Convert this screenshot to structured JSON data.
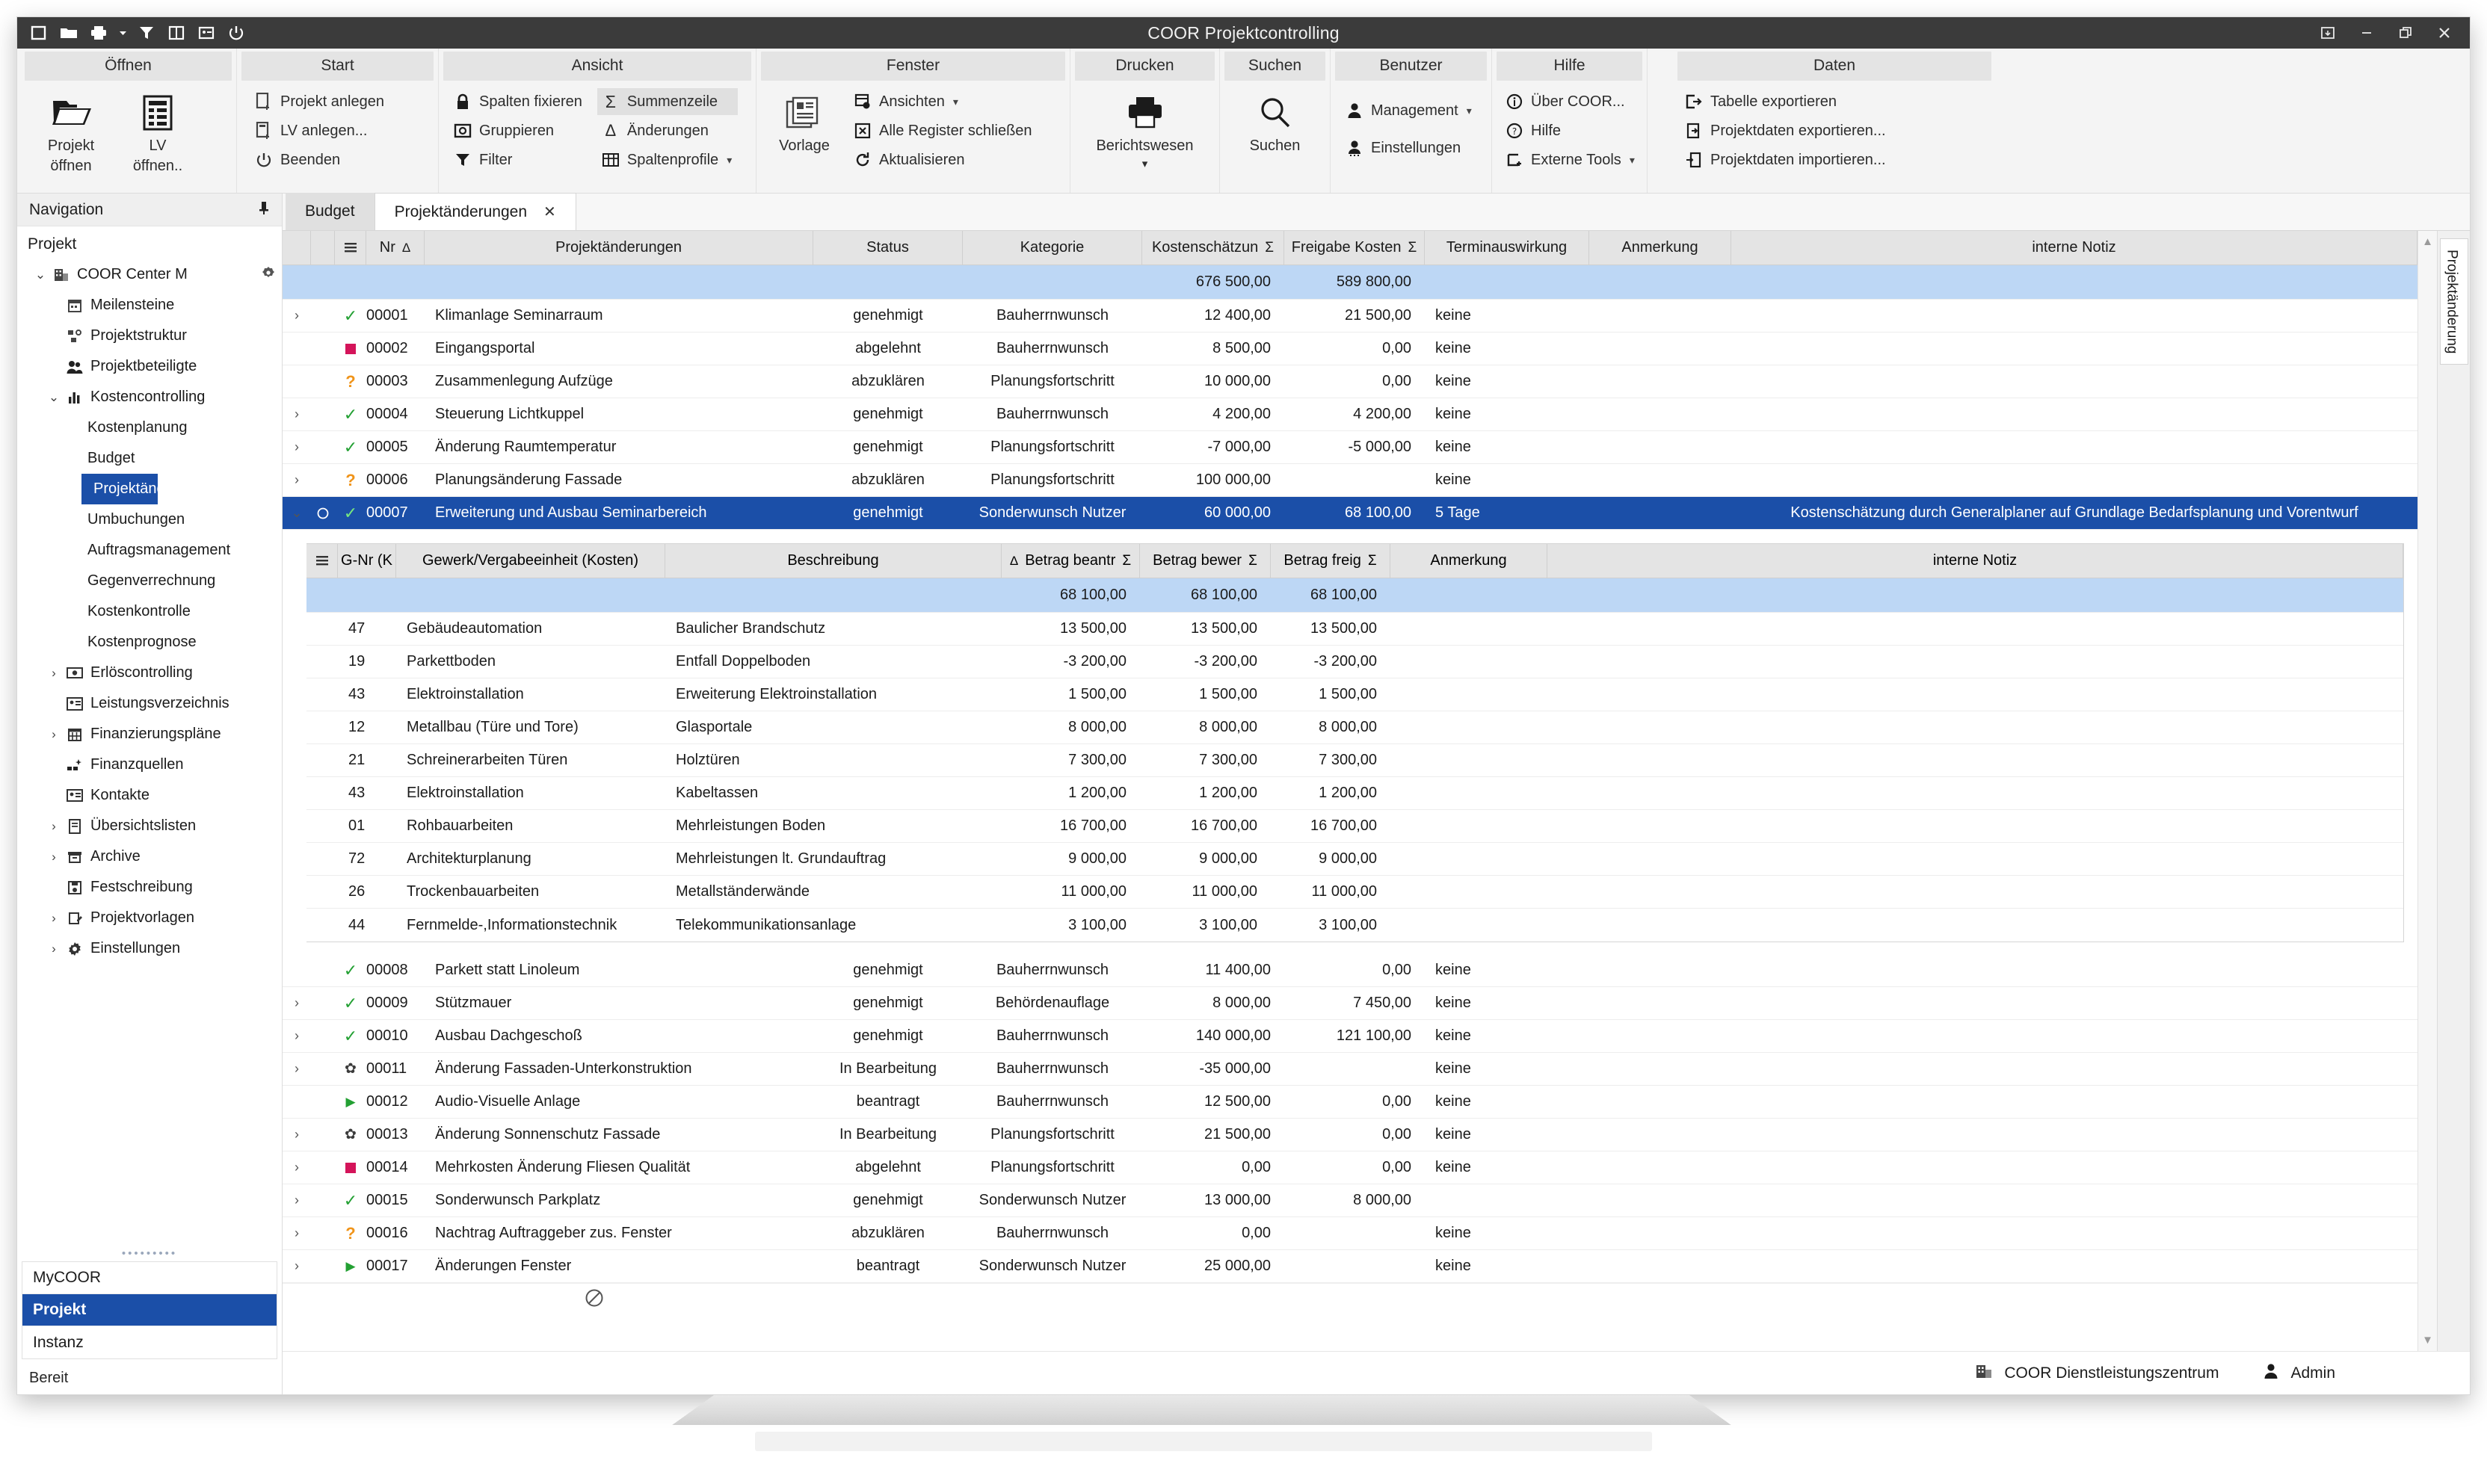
{
  "window": {
    "title": "COOR Projektcontrolling",
    "quick_access": [
      "window-icon",
      "open-folder-icon",
      "print-icon",
      "filter-icon",
      "report-icon",
      "card-icon",
      "power-icon"
    ],
    "controls": [
      "restore-down-icon",
      "minimize-icon",
      "maximize-icon",
      "close-icon"
    ]
  },
  "ribbon": {
    "groups": [
      {
        "title": "Öffnen",
        "big_buttons": [
          {
            "label_1": "Projekt",
            "label_2": "öffnen",
            "icon": "folder-open-icon"
          },
          {
            "label_1": "LV",
            "label_2": "öffnen..",
            "icon": "lv-open-icon"
          }
        ],
        "small_buttons": []
      },
      {
        "title": "Start",
        "big_buttons": [],
        "small_buttons": [
          {
            "label": "Projekt anlegen",
            "icon": "project-new-icon"
          },
          {
            "label": "LV anlegen...",
            "icon": "lv-new-icon"
          },
          {
            "label": "Beenden",
            "icon": "power-icon"
          }
        ]
      },
      {
        "title": "Ansicht",
        "big_buttons": [],
        "small_buttons": [
          {
            "label": "Spalten fixieren",
            "icon": "lock-icon"
          },
          {
            "label": "Gruppieren",
            "icon": "group-icon"
          },
          {
            "label": "Filter",
            "icon": "filter-icon"
          }
        ],
        "small_buttons_2": [
          {
            "label": "Summenzeile",
            "icon": "sigma-icon",
            "active": true
          },
          {
            "label": "Änderungen",
            "icon": "delta-icon"
          },
          {
            "label": "Spaltenprofile",
            "icon": "table-icon",
            "caret": true
          }
        ]
      },
      {
        "title": "Fenster",
        "big_buttons": [
          {
            "label_1": "Vorlage",
            "label_2": "",
            "icon": "template-icon"
          }
        ],
        "small_buttons": [
          {
            "label": "Ansichten",
            "icon": "views-icon",
            "caret": true
          },
          {
            "label": "Alle Register schließen",
            "icon": "close-box-icon"
          },
          {
            "label": "Aktualisieren",
            "icon": "refresh-icon"
          }
        ]
      },
      {
        "title": "Drucken",
        "big_buttons": [
          {
            "label_1": "Berichtswesen",
            "label_2": "▾",
            "icon": "printer-icon"
          }
        ],
        "small_buttons": []
      },
      {
        "title": "Suchen",
        "big_buttons": [
          {
            "label_1": "Suchen",
            "label_2": "",
            "icon": "search-icon"
          }
        ],
        "small_buttons": []
      },
      {
        "title": "Benutzer",
        "big_buttons": [],
        "small_buttons": [
          {
            "label": "Management",
            "icon": "user-icon",
            "caret": true
          },
          {
            "label": "Einstellungen",
            "icon": "user-settings-icon"
          }
        ]
      },
      {
        "title": "Hilfe",
        "big_buttons": [],
        "small_buttons": [
          {
            "label": "Über COOR...",
            "icon": "info-icon"
          },
          {
            "label": "Hilfe",
            "icon": "question-icon"
          },
          {
            "label": "Externe Tools",
            "icon": "tools-icon",
            "caret": true
          }
        ]
      },
      {
        "title": "Daten",
        "big_buttons": [],
        "small_buttons": [
          {
            "label": "Tabelle exportieren",
            "icon": "export-table-icon"
          },
          {
            "label": "Projektdaten exportieren...",
            "icon": "export-data-icon"
          },
          {
            "label": "Projektdaten importieren...",
            "icon": "import-data-icon"
          }
        ]
      }
    ]
  },
  "sidebar": {
    "header": "Navigation",
    "pin_icon": "pin-icon",
    "section_title": "Projekt",
    "tree": [
      {
        "label": "COOR Center M",
        "icon": "building-icon",
        "expander": "chevron-down",
        "indent": 0,
        "gear": true
      },
      {
        "label": "Meilensteine",
        "icon": "calendar-icon",
        "expander": "",
        "indent": 1
      },
      {
        "label": "Projektstruktur",
        "icon": "structure-icon",
        "expander": "",
        "indent": 1
      },
      {
        "label": "Projektbeteiligte",
        "icon": "people-icon",
        "expander": "",
        "indent": 1
      },
      {
        "label": "Kostencontrolling",
        "icon": "bars-icon",
        "expander": "chevron-down",
        "indent": 1
      },
      {
        "label": "Kostenplanung",
        "icon": "",
        "expander": "",
        "indent": 2
      },
      {
        "label": "Budget",
        "icon": "",
        "expander": "",
        "indent": 2
      },
      {
        "label": "Projektänderungen",
        "icon": "",
        "expander": "",
        "indent": 2,
        "selected": true
      },
      {
        "label": "Umbuchungen",
        "icon": "",
        "expander": "",
        "indent": 2
      },
      {
        "label": "Auftragsmanagement",
        "icon": "",
        "expander": "",
        "indent": 2
      },
      {
        "label": "Gegenverrechnung",
        "icon": "",
        "expander": "",
        "indent": 2
      },
      {
        "label": "Kostenkontrolle",
        "icon": "",
        "expander": "",
        "indent": 2
      },
      {
        "label": "Kostenprognose",
        "icon": "",
        "expander": "",
        "indent": 2
      },
      {
        "label": "Erlöscontrolling",
        "icon": "money-icon",
        "expander": "chevron-right",
        "indent": 1
      },
      {
        "label": "Leistungsverzeichnis",
        "icon": "lv-icon",
        "expander": "",
        "indent": 1
      },
      {
        "label": "Finanzierungspläne",
        "icon": "calendar-grid-icon",
        "expander": "chevron-right",
        "indent": 1
      },
      {
        "label": "Finanzquellen",
        "icon": "sources-icon",
        "expander": "",
        "indent": 1
      },
      {
        "label": "Kontakte",
        "icon": "contact-card-icon",
        "expander": "",
        "indent": 1
      },
      {
        "label": "Übersichtslisten",
        "icon": "document-icon",
        "expander": "chevron-right",
        "indent": 1
      },
      {
        "label": "Archive",
        "icon": "archive-icon",
        "expander": "chevron-right",
        "indent": 1
      },
      {
        "label": "Festschreibung",
        "icon": "save-icon",
        "expander": "",
        "indent": 1
      },
      {
        "label": "Projektvorlagen",
        "icon": "clipboard-edit-icon",
        "expander": "chevron-right",
        "indent": 1
      },
      {
        "label": "Einstellungen",
        "icon": "gear-icon",
        "expander": "chevron-right",
        "indent": 1
      }
    ],
    "panels": [
      {
        "label": "MyCOOR",
        "selected": false
      },
      {
        "label": "Projekt",
        "selected": true
      },
      {
        "label": "Instanz",
        "selected": false
      }
    ],
    "status": "Bereit"
  },
  "tabs": [
    {
      "label": "Budget",
      "active": false,
      "closable": false
    },
    {
      "label": "Projektänderungen",
      "active": true,
      "closable": true,
      "close_label": "✕"
    }
  ],
  "vertical_tab": "Projektänderung",
  "grid": {
    "columns": [
      {
        "key": "menu",
        "label": "",
        "icon": "grid-menu-icon"
      },
      {
        "key": "nr",
        "label": "Nr",
        "tri": "Δ"
      },
      {
        "key": "name",
        "label": "Projektänderungen"
      },
      {
        "key": "status",
        "label": "Status"
      },
      {
        "key": "kategorie",
        "label": "Kategorie"
      },
      {
        "key": "kostenschaetzung",
        "label": "Kostenschätzun",
        "sigma": "Σ"
      },
      {
        "key": "freigabe",
        "label": "Freigabe Kosten",
        "sigma": "Σ"
      },
      {
        "key": "termin",
        "label": "Terminauswirkung"
      },
      {
        "key": "anmerkung",
        "label": "Anmerkung"
      },
      {
        "key": "notiz",
        "label": "interne Notiz"
      }
    ],
    "total_row": {
      "kostenschaetzung": "676 500,00",
      "freigabe": "589 800,00"
    },
    "rows": [
      {
        "expander": true,
        "status_icon": "check",
        "nr": "00001",
        "name": "Klimanlage Seminarraum",
        "status": "genehmigt",
        "kategorie": "Bauherrnwunsch",
        "kostenschaetzung": "12 400,00",
        "freigabe": "21 500,00",
        "termin": "keine",
        "anmerkung": "",
        "notiz": ""
      },
      {
        "expander": false,
        "status_icon": "square",
        "nr": "00002",
        "name": "Eingangsportal",
        "status": "abgelehnt",
        "kategorie": "Bauherrnwunsch",
        "kostenschaetzung": "8 500,00",
        "freigabe": "0,00",
        "termin": "keine",
        "anmerkung": "",
        "notiz": ""
      },
      {
        "expander": false,
        "status_icon": "question",
        "nr": "00003",
        "name": "Zusammenlegung Aufzüge",
        "status": "abzuklären",
        "kategorie": "Planungsfortschritt",
        "kostenschaetzung": "10 000,00",
        "freigabe": "0,00",
        "termin": "keine",
        "anmerkung": "",
        "notiz": ""
      },
      {
        "expander": true,
        "status_icon": "check",
        "nr": "00004",
        "name": "Steuerung Lichtkuppel",
        "status": "genehmigt",
        "kategorie": "Bauherrnwunsch",
        "kostenschaetzung": "4 200,00",
        "freigabe": "4 200,00",
        "termin": "keine",
        "anmerkung": "",
        "notiz": ""
      },
      {
        "expander": true,
        "status_icon": "check",
        "nr": "00005",
        "name": "Änderung Raumtemperatur",
        "status": "genehmigt",
        "kategorie": "Planungsfortschritt",
        "kostenschaetzung": "-7 000,00",
        "freigabe": "-5 000,00",
        "termin": "keine",
        "anmerkung": "",
        "notiz": ""
      },
      {
        "expander": true,
        "status_icon": "question",
        "nr": "00006",
        "name": "Planungsänderung Fassade",
        "status": "abzuklären",
        "kategorie": "Planungsfortschritt",
        "kostenschaetzung": "100 000,00",
        "freigabe": "",
        "termin": "keine",
        "anmerkung": "",
        "notiz": ""
      },
      {
        "expander": true,
        "expanded": true,
        "selected": true,
        "circle": true,
        "status_icon": "check",
        "nr": "00007",
        "name": "Erweiterung und Ausbau Seminarbereich",
        "status": "genehmigt",
        "kategorie": "Sonderwunsch Nutzer",
        "kostenschaetzung": "60 000,00",
        "freigabe": "68 100,00",
        "termin": "5 Tage",
        "anmerkung": "",
        "notiz": "Kostenschätzung durch Generalplaner auf Grundlage Bedarfsplanung und Vorentwurf"
      },
      {
        "expander": false,
        "status_icon": "check",
        "nr": "00008",
        "name": "Parkett statt Linoleum",
        "status": "genehmigt",
        "kategorie": "Bauherrnwunsch",
        "kostenschaetzung": "11 400,00",
        "freigabe": "0,00",
        "termin": "keine",
        "anmerkung": "",
        "notiz": ""
      },
      {
        "expander": true,
        "status_icon": "check",
        "nr": "00009",
        "name": "Stützmauer",
        "status": "genehmigt",
        "kategorie": "Behördenauflage",
        "kostenschaetzung": "8 000,00",
        "freigabe": "7 450,00",
        "termin": "keine",
        "anmerkung": "",
        "notiz": ""
      },
      {
        "expander": true,
        "status_icon": "check",
        "nr": "00010",
        "name": "Ausbau Dachgeschoß",
        "status": "genehmigt",
        "kategorie": "Bauherrnwunsch",
        "kostenschaetzung": "140 000,00",
        "freigabe": "121 100,00",
        "termin": "keine",
        "anmerkung": "",
        "notiz": ""
      },
      {
        "expander": true,
        "status_icon": "gear",
        "nr": "00011",
        "name": "Änderung Fassaden-Unterkonstruktion",
        "status": "In Bearbeitung",
        "kategorie": "Bauherrnwunsch",
        "kostenschaetzung": "-35 000,00",
        "freigabe": "",
        "termin": "keine",
        "anmerkung": "",
        "notiz": ""
      },
      {
        "expander": false,
        "status_icon": "triangle",
        "nr": "00012",
        "name": "Audio-Visuelle Anlage",
        "status": "beantragt",
        "kategorie": "Bauherrnwunsch",
        "kostenschaetzung": "12 500,00",
        "freigabe": "0,00",
        "termin": "keine",
        "anmerkung": "",
        "notiz": ""
      },
      {
        "expander": true,
        "status_icon": "gear",
        "nr": "00013",
        "name": "Änderung Sonnenschutz Fassade",
        "status": "In Bearbeitung",
        "kategorie": "Planungsfortschritt",
        "kostenschaetzung": "21 500,00",
        "freigabe": "0,00",
        "termin": "keine",
        "anmerkung": "",
        "notiz": ""
      },
      {
        "expander": true,
        "status_icon": "square",
        "nr": "00014",
        "name": "Mehrkosten Änderung Fliesen Qualität",
        "status": "abgelehnt",
        "kategorie": "Planungsfortschritt",
        "kostenschaetzung": "0,00",
        "freigabe": "0,00",
        "termin": "keine",
        "anmerkung": "",
        "notiz": ""
      },
      {
        "expander": true,
        "status_icon": "check",
        "nr": "00015",
        "name": "Sonderwunsch Parkplatz",
        "status": "genehmigt",
        "kategorie": "Sonderwunsch Nutzer",
        "kostenschaetzung": "13 000,00",
        "freigabe": "8 000,00",
        "termin": "",
        "anmerkung": "",
        "notiz": ""
      },
      {
        "expander": true,
        "status_icon": "question",
        "nr": "00016",
        "name": "Nachtrag Auftraggeber zus. Fenster",
        "status": "abzuklären",
        "kategorie": "Bauherrnwunsch",
        "kostenschaetzung": "0,00",
        "freigabe": "",
        "termin": "keine",
        "anmerkung": "",
        "notiz": ""
      },
      {
        "expander": true,
        "status_icon": "triangle",
        "nr": "00017",
        "name": "Änderungen Fenster",
        "status": "beantragt",
        "kategorie": "Sonderwunsch Nutzer",
        "kostenschaetzung": "25 000,00",
        "freigabe": "",
        "termin": "keine",
        "anmerkung": "",
        "notiz": ""
      }
    ]
  },
  "detail_grid": {
    "columns": [
      {
        "key": "menu",
        "label": "",
        "icon": "grid-menu-icon"
      },
      {
        "key": "gnr",
        "label": "G-Nr (K"
      },
      {
        "key": "gewerk",
        "label": "Gewerk/Vergabeeinheit (Kosten)"
      },
      {
        "key": "beschreibung",
        "label": "Beschreibung"
      },
      {
        "key": "beantr",
        "label": "Betrag beantr",
        "tri": "Δ",
        "sigma": "Σ"
      },
      {
        "key": "bewer",
        "label": "Betrag bewer",
        "sigma": "Σ"
      },
      {
        "key": "freig",
        "label": "Betrag freig",
        "sigma": "Σ"
      },
      {
        "key": "anmerkung",
        "label": "Anmerkung"
      },
      {
        "key": "notiz",
        "label": "interne Notiz"
      }
    ],
    "total_row": {
      "beantr": "68 100,00",
      "bewer": "68 100,00",
      "freig": "68 100,00"
    },
    "rows": [
      {
        "gnr": "47",
        "gewerk": "Gebäudeautomation",
        "beschreibung": "Baulicher Brandschutz",
        "beantr": "13 500,00",
        "bewer": "13 500,00",
        "freig": "13 500,00",
        "anmerkung": "",
        "notiz": ""
      },
      {
        "gnr": "19",
        "gewerk": "Parkettboden",
        "beschreibung": "Entfall Doppelboden",
        "beantr": "-3 200,00",
        "bewer": "-3 200,00",
        "freig": "-3 200,00",
        "anmerkung": "",
        "notiz": ""
      },
      {
        "gnr": "43",
        "gewerk": "Elektroinstallation",
        "beschreibung": "Erweiterung Elektroinstallation",
        "beantr": "1 500,00",
        "bewer": "1 500,00",
        "freig": "1 500,00",
        "anmerkung": "",
        "notiz": ""
      },
      {
        "gnr": "12",
        "gewerk": "Metallbau (Türe und Tore)",
        "beschreibung": "Glasportale",
        "beantr": "8 000,00",
        "bewer": "8 000,00",
        "freig": "8 000,00",
        "anmerkung": "",
        "notiz": ""
      },
      {
        "gnr": "21",
        "gewerk": "Schreinerarbeiten Türen",
        "beschreibung": "Holztüren",
        "beantr": "7 300,00",
        "bewer": "7 300,00",
        "freig": "7 300,00",
        "anmerkung": "",
        "notiz": ""
      },
      {
        "gnr": "43",
        "gewerk": "Elektroinstallation",
        "beschreibung": "Kabeltassen",
        "beantr": "1 200,00",
        "bewer": "1 200,00",
        "freig": "1 200,00",
        "anmerkung": "",
        "notiz": ""
      },
      {
        "gnr": "01",
        "gewerk": "Rohbauarbeiten",
        "beschreibung": "Mehrleistungen Boden",
        "beantr": "16 700,00",
        "bewer": "16 700,00",
        "freig": "16 700,00",
        "anmerkung": "",
        "notiz": ""
      },
      {
        "gnr": "72",
        "gewerk": "Architekturplanung",
        "beschreibung": "Mehrleistungen lt. Grundauftrag",
        "beantr": "9 000,00",
        "bewer": "9 000,00",
        "freig": "9 000,00",
        "anmerkung": "",
        "notiz": ""
      },
      {
        "gnr": "26",
        "gewerk": "Trockenbauarbeiten",
        "beschreibung": "Metallständerwände",
        "beantr": "11 000,00",
        "bewer": "11 000,00",
        "freig": "11 000,00",
        "anmerkung": "",
        "notiz": ""
      },
      {
        "gnr": "44",
        "gewerk": "Fernmelde-,Informationstechnik",
        "beschreibung": "Telekommunikationsanlage",
        "beantr": "3 100,00",
        "bewer": "3 100,00",
        "freig": "3 100,00",
        "anmerkung": "",
        "notiz": ""
      }
    ]
  },
  "statusbar": {
    "organization": "COOR Dienstleistungszentrum",
    "user": "Admin",
    "org_icon": "building-icon",
    "user_icon": "user-icon"
  },
  "colors": {
    "accent": "#1b4fa8",
    "total_row": "#bdd7f5",
    "titlebar": "#3b3b3b",
    "ok": "#23a033",
    "reject": "#d4145a",
    "pending": "#f0941a"
  }
}
